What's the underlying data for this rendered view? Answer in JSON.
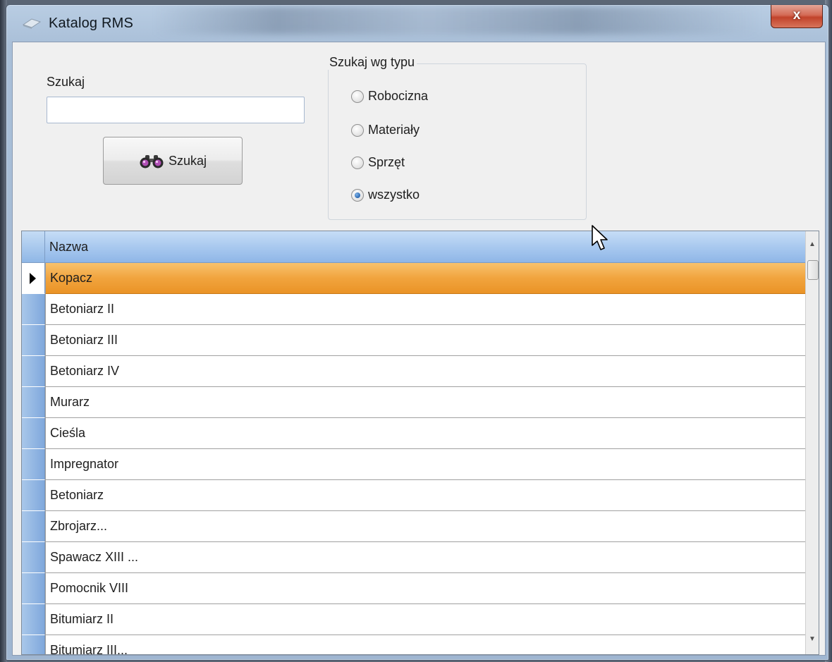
{
  "window": {
    "title": "Katalog RMS",
    "close_symbol": "x",
    "icon": "app-icon"
  },
  "search": {
    "label": "Szukaj",
    "input_value": "",
    "button_label": "Szukaj",
    "button_icon": "binoculars-icon"
  },
  "type_filter": {
    "legend": "Szukaj wg typu",
    "options": [
      {
        "label": "Robocizna",
        "checked": false
      },
      {
        "label": "Materiały",
        "checked": false
      },
      {
        "label": "Sprzęt",
        "checked": false
      },
      {
        "label": "wszystko",
        "checked": true
      }
    ]
  },
  "grid": {
    "column_header": "Nazwa",
    "selected_index": 0,
    "rows": [
      "Kopacz",
      "Betoniarz II",
      "Betoniarz III",
      "Betoniarz IV",
      "Murarz",
      "Cieśla",
      "Impregnator",
      "Betoniarz",
      "Zbrojarz...",
      "Spawacz XIII ...",
      "Pomocnik VIII",
      "Bitumiarz II",
      "Bitumiarz III..."
    ]
  },
  "colors": {
    "selection": "#f1a43e",
    "header": "#a9c9ef",
    "titlebar": "#b9cde3"
  }
}
